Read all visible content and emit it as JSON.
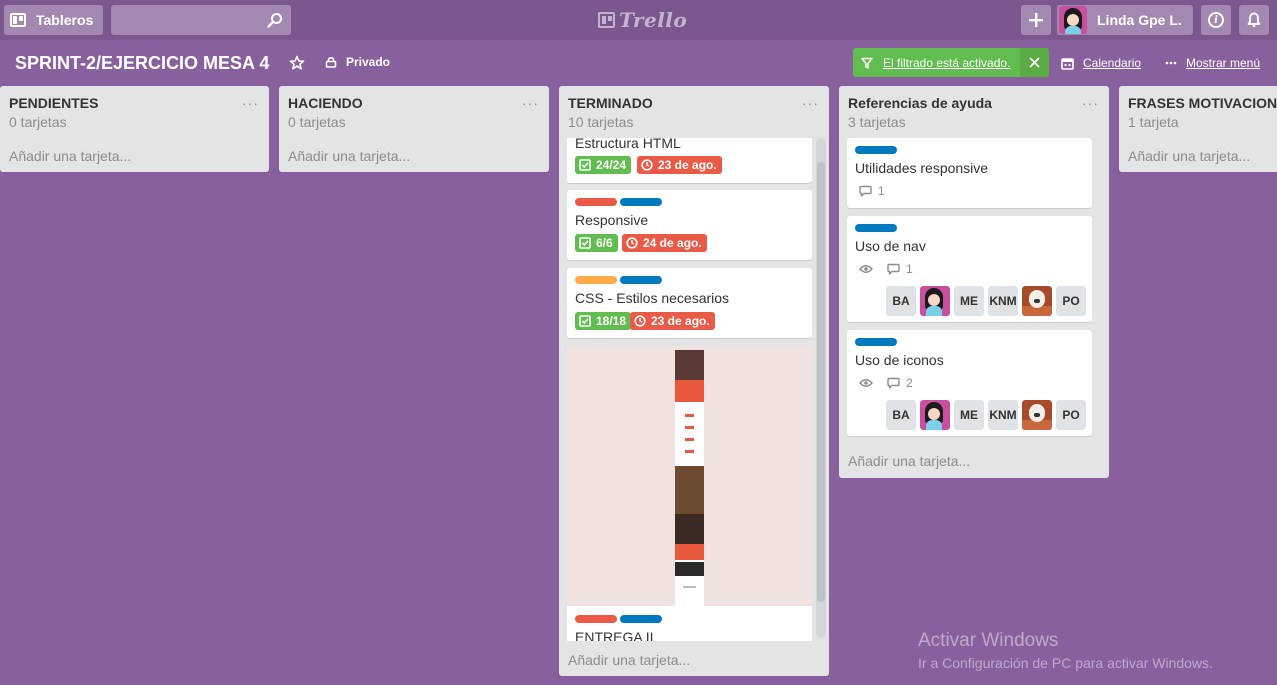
{
  "header": {
    "boards_label": "Tableros",
    "search_placeholder": "",
    "logo_text": "Trello",
    "user_name": "Linda Gpe L."
  },
  "board": {
    "title": "SPRINT-2/EJERCICIO MESA 4",
    "visibility": "Privado",
    "filter_label": "El filtrado está activado.",
    "calendar_label": "Calendario",
    "menu_label": "Mostrar menú"
  },
  "lists": [
    {
      "title": "PENDIENTES",
      "count": "0 tarjetas",
      "menu": "···",
      "add": "Añadir una tarjeta..."
    },
    {
      "title": "HACIENDO",
      "count": "0 tarjetas",
      "menu": "···",
      "add": "Añadir una tarjeta..."
    },
    {
      "title": "TERMINADO",
      "count": "10 tarjetas",
      "menu": "···",
      "add": "Añadir una tarjeta...",
      "cards": [
        {
          "title": "Estructura HTML",
          "checklist": "24/24",
          "due": "23 de ago."
        },
        {
          "title": "Responsive",
          "checklist": "6/6",
          "due": "24 de ago.",
          "labels": [
            "red",
            "blue"
          ]
        },
        {
          "title": "CSS - Estilos necesarios",
          "checklist": "18/18",
          "due": "23 de ago.",
          "labels": [
            "orange",
            "blue"
          ]
        },
        {
          "title": "ENTREGA II",
          "labels": [
            "red",
            "blue"
          ]
        }
      ]
    },
    {
      "title": "Referencias de ayuda",
      "count": "3 tarjetas",
      "menu": "···",
      "add": "Añadir una tarjeta...",
      "cards": [
        {
          "title": "Utilidades responsive",
          "comments": "1",
          "labels": [
            "blue"
          ]
        },
        {
          "title": "Uso de nav",
          "comments": "1",
          "labels": [
            "blue"
          ],
          "members": [
            "BA",
            "ME",
            "KNM",
            "PO"
          ]
        },
        {
          "title": "Uso de iconos",
          "comments": "2",
          "labels": [
            "blue"
          ],
          "members": [
            "BA",
            "ME",
            "KNM",
            "PO"
          ]
        }
      ]
    },
    {
      "title": "FRASES MOTIVACIONALES",
      "count": "1 tarjeta",
      "add": "Añadir una tarjeta..."
    }
  ],
  "watermark": {
    "line1": "Activar Windows",
    "line2": "Ir a Configuración de PC para activar Windows."
  },
  "colors": {
    "background": "#89609e",
    "header": "#7b5790",
    "label_red": "#eb5a46",
    "label_blue": "#0079bf",
    "label_orange": "#ffab4a",
    "badge_green": "#61bd4f",
    "badge_red": "#eb5a46",
    "filter_green": "#61bd4f"
  },
  "icons": [
    "boards-icon",
    "search-icon",
    "trello-logo-icon",
    "plus-icon",
    "info-icon",
    "bell-icon",
    "star-icon",
    "lock-icon",
    "filter-icon",
    "close-icon",
    "calendar-icon",
    "ellipsis-icon",
    "checklist-icon",
    "clock-icon",
    "comment-icon",
    "eye-icon"
  ]
}
